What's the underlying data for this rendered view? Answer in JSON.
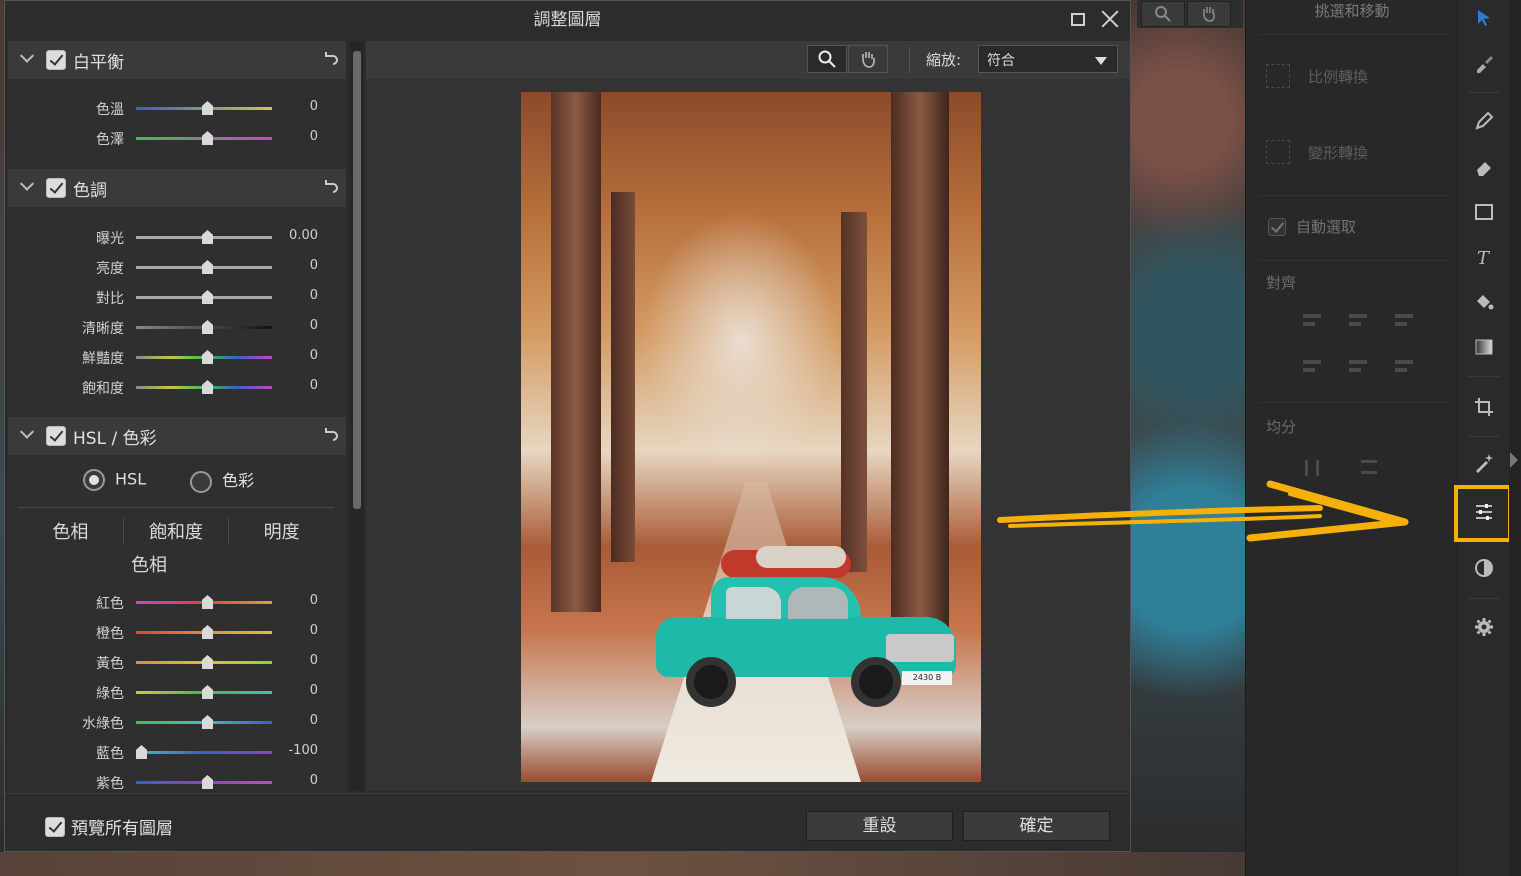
{
  "dialog": {
    "title": "調整圖層",
    "sections": {
      "white_balance": {
        "label": "白平衡",
        "rows": [
          {
            "label": "色溫",
            "value": "0"
          },
          {
            "label": "色澤",
            "value": "0"
          }
        ]
      },
      "tone": {
        "label": "色調",
        "rows": [
          {
            "label": "曝光",
            "value": "0.00"
          },
          {
            "label": "亮度",
            "value": "0"
          },
          {
            "label": "對比",
            "value": "0"
          },
          {
            "label": "清晰度",
            "value": "0"
          },
          {
            "label": "鮮豔度",
            "value": "0"
          },
          {
            "label": "飽和度",
            "value": "0"
          }
        ]
      },
      "hsl": {
        "label": "HSL / 色彩",
        "radio_hsl": "HSL",
        "radio_color": "色彩",
        "tabs": [
          "色相",
          "飽和度",
          "明度"
        ],
        "subhead": "色相",
        "rows": [
          {
            "label": "紅色",
            "value": "0"
          },
          {
            "label": "橙色",
            "value": "0"
          },
          {
            "label": "黃色",
            "value": "0"
          },
          {
            "label": "綠色",
            "value": "0"
          },
          {
            "label": "水綠色",
            "value": "0"
          },
          {
            "label": "藍色",
            "value": "-100"
          },
          {
            "label": "紫色",
            "value": "0"
          }
        ]
      }
    },
    "zoom_label": "縮放:",
    "zoom_value": "符合",
    "preview_all_label": "預覽所有圖層",
    "reset_label": "重設",
    "ok_label": "確定"
  },
  "right_panel": {
    "title": "挑選和移動",
    "proportional_transform": "比例轉換",
    "deform_transform": "變形轉換",
    "auto_select": "自動選取",
    "align_title": "對齊",
    "distribute_title": "均分"
  },
  "photo": {
    "plate": "2430 B"
  },
  "colors": {
    "highlight": "#f5b10a",
    "accent": "#2e7bd6"
  }
}
